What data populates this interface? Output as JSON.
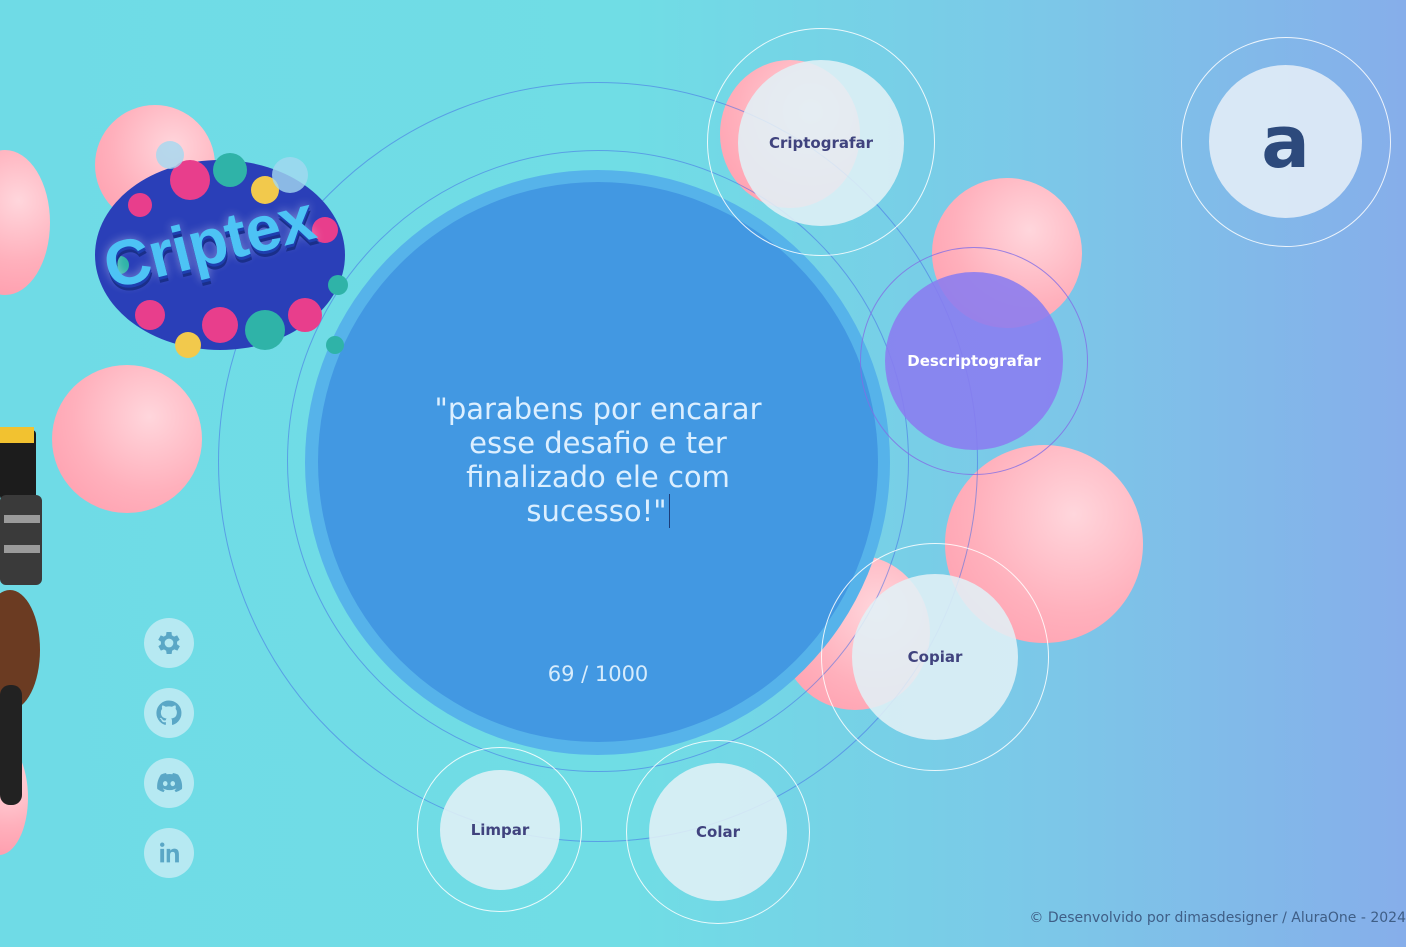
{
  "app": {
    "logo_text": "Criptex",
    "brand_logo_letter": "a"
  },
  "editor": {
    "message": "\"parabens por encarar esse desafio e ter finalizado ele com sucesso!\"",
    "counter": "69 / 1000"
  },
  "actions": {
    "encrypt_label": "Criptografar",
    "decrypt_label": "Descriptografar",
    "copy_label": "Copiar",
    "clear_label": "Limpar",
    "paste_label": "Colar"
  },
  "sidebar": {
    "icons": [
      "gear-icon",
      "github-icon",
      "discord-icon",
      "linkedin-icon"
    ]
  },
  "footer": {
    "text": "© Desenvolvido por dimasdesigner / AluraOne - 2024"
  },
  "colors": {
    "background_start": "#6fdbe6",
    "background_end": "#86aeea",
    "main_circle": "#4298e2",
    "decrypt_button": "#8b83ef",
    "button_text": "#40437e",
    "pink_blob": "#ffb0bc"
  }
}
